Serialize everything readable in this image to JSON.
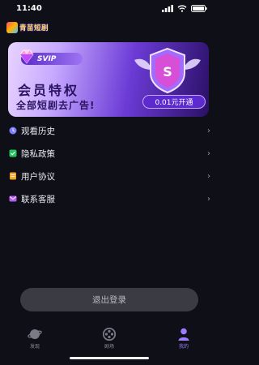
{
  "status_bar": {
    "time": "11:40"
  },
  "app": {
    "logo_text": "青苗短剧"
  },
  "vip_card": {
    "badge_text": "SVIP",
    "title": "会员特权",
    "subtitle": "全部短剧去广告!",
    "open_button": "0.01元开通",
    "colors": {
      "accent": "#5d2ad0",
      "text": "#2a1460"
    }
  },
  "menu": {
    "items": [
      {
        "label": "观看历史",
        "icon": "history-icon",
        "color": "#7b7fff"
      },
      {
        "label": "隐私政策",
        "icon": "privacy-shield-icon",
        "color": "#22c55e"
      },
      {
        "label": "用户协议",
        "icon": "agreement-doc-icon",
        "color": "#f5a524"
      },
      {
        "label": "联系客服",
        "icon": "customer-service-mail-icon",
        "color": "#b25cf0"
      }
    ],
    "chevron": "›"
  },
  "logout": {
    "label": "退出登录"
  },
  "tab_bar": {
    "tabs": [
      {
        "label": "发现",
        "icon": "discover-planet-icon",
        "active": false
      },
      {
        "label": "剧场",
        "icon": "theater-reel-icon",
        "active": false
      },
      {
        "label": "我的",
        "icon": "profile-person-icon",
        "active": true
      }
    ],
    "active_color": "#9b7cff"
  }
}
